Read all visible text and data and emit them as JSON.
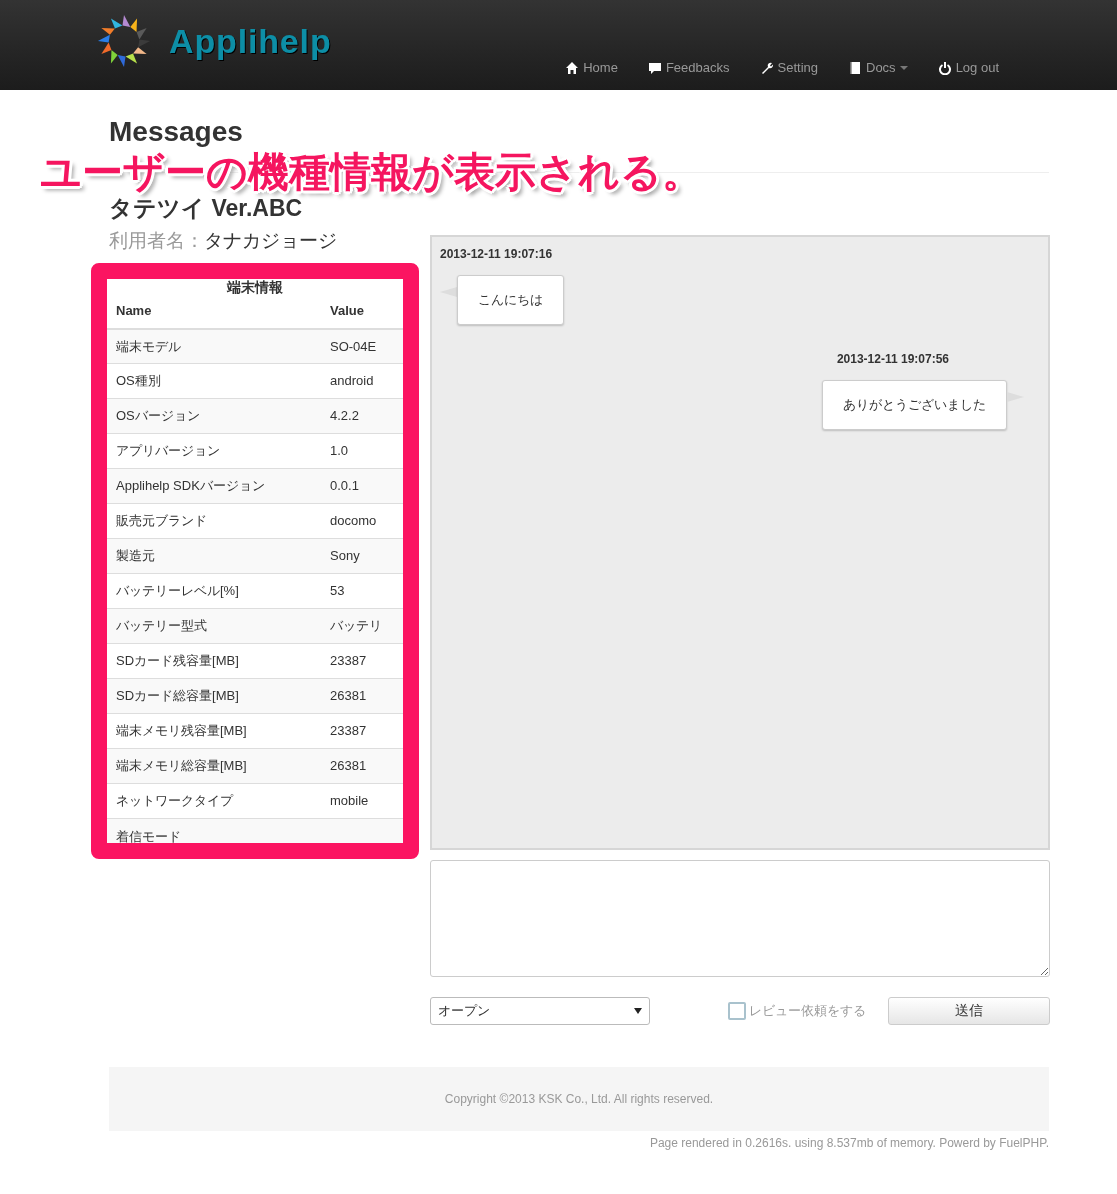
{
  "navbar": {
    "brand": "Applihelp",
    "items": [
      {
        "label": "Home",
        "kind": "home",
        "dropdown": false
      },
      {
        "label": "Feedbacks",
        "kind": "comment",
        "dropdown": false
      },
      {
        "label": "Setting",
        "kind": "wrench",
        "dropdown": false
      },
      {
        "label": "Docs",
        "kind": "book",
        "dropdown": true
      },
      {
        "label": "Log out",
        "kind": "power",
        "dropdown": false
      }
    ]
  },
  "page_title": "Messages",
  "annotation": "ユーザーの機種情報が表示される。",
  "app_name": "タテツイ Ver.ABC",
  "user": {
    "label": "利用者名：",
    "name": "タナカジョージ"
  },
  "device_info": {
    "title": "端末情報",
    "columns": [
      "Name",
      "Value"
    ],
    "rows": [
      [
        "端末モデル",
        "SO-04E"
      ],
      [
        "OS種別",
        "android"
      ],
      [
        "OSバージョン",
        "4.2.2"
      ],
      [
        "アプリバージョン",
        "1.0"
      ],
      [
        "Applihelp SDKバージョン",
        "0.0.1"
      ],
      [
        "販売元ブランド",
        "docomo"
      ],
      [
        "製造元",
        "Sony"
      ],
      [
        "バッテリーレベル[%]",
        "53"
      ],
      [
        "バッテリー型式",
        "バッテリ"
      ],
      [
        "SDカード残容量[MB]",
        "23387"
      ],
      [
        "SDカード総容量[MB]",
        "26381"
      ],
      [
        "端末メモリ残容量[MB]",
        "23387"
      ],
      [
        "端末メモリ総容量[MB]",
        "26381"
      ],
      [
        "ネットワークタイプ",
        "mobile"
      ],
      [
        "着信モード",
        ""
      ]
    ]
  },
  "messages": [
    {
      "kind": "received",
      "time": "2013-12-11 19:07:16",
      "text": "こんにちは"
    },
    {
      "kind": "sent",
      "time": "2013-12-11 19:07:56",
      "text": "ありがとうございました"
    }
  ],
  "status_select": {
    "value": "オープン"
  },
  "review_checkbox": {
    "label": "レビュー依頼をする",
    "checked": false
  },
  "send_button": "送信",
  "footer": {
    "copyright": "Copyright ©2013 KSK Co., Ltd. All rights reserved.",
    "rendered": "Page rendered in 0.2616s. using 8.537mb of memory. Powerd by FuelPHP."
  }
}
